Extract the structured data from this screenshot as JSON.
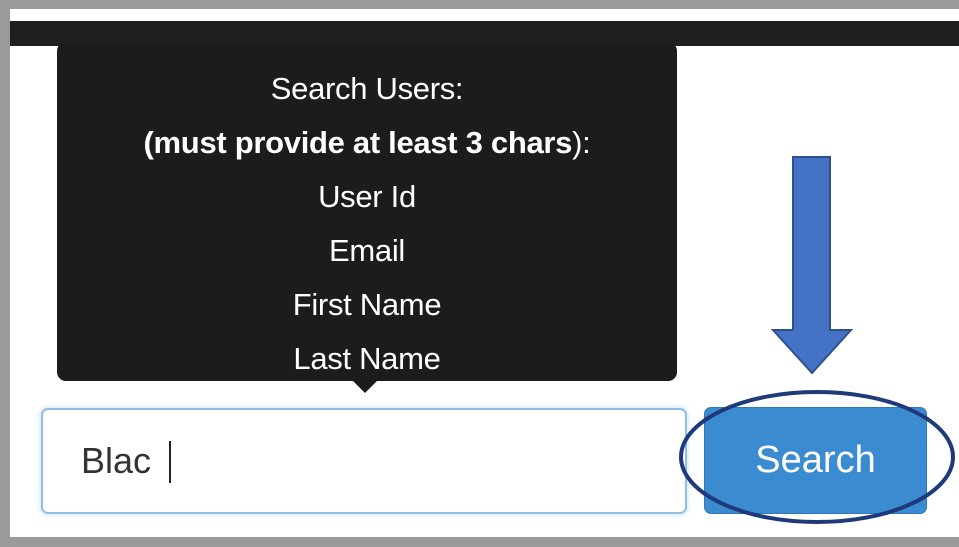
{
  "tooltip": {
    "title": "Search Users:",
    "requirement_bold": "(must provide at least 3 chars",
    "requirement_tail": "):",
    "fields": [
      "User Id",
      "Email",
      "First Name",
      "Last Name"
    ]
  },
  "search": {
    "value": "Blac",
    "button_label": "Search"
  },
  "colors": {
    "button": "#3b8bd0",
    "annotation": "#4472c4",
    "annotation_outline": "#1f3a7a",
    "tooltip_bg": "#1c1c1c"
  }
}
